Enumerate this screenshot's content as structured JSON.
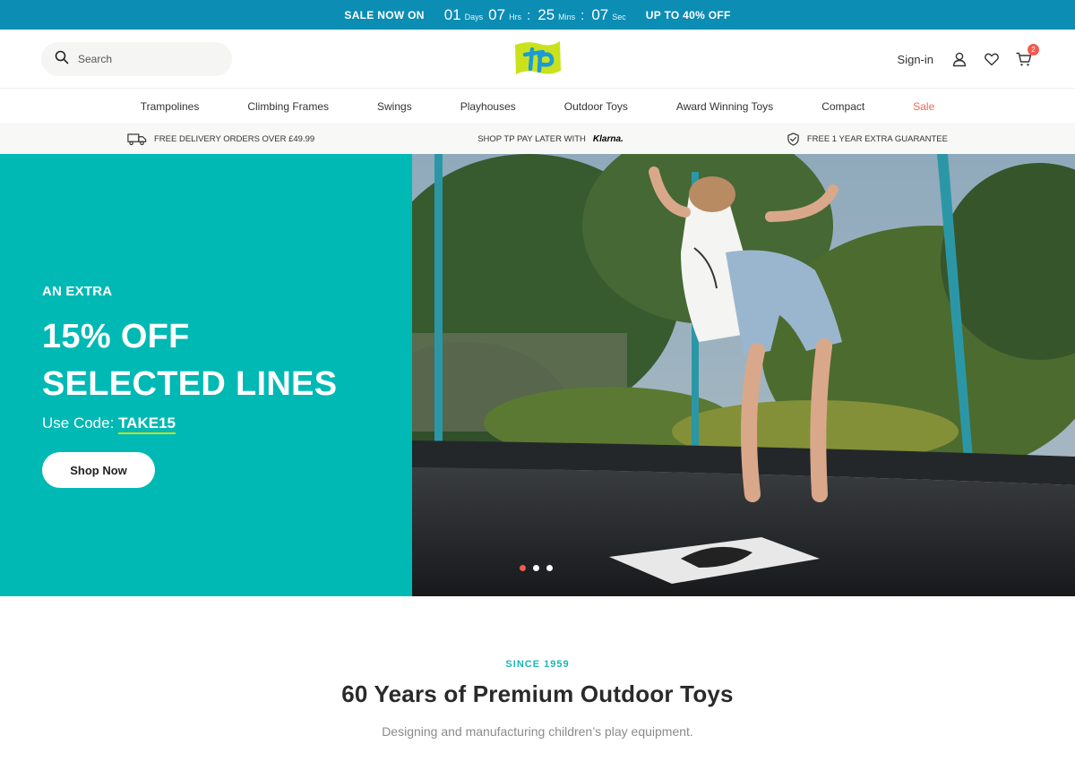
{
  "topbar": {
    "sale_label": "SALE NOW ON",
    "countdown": [
      {
        "value": "01",
        "unit": "Days"
      },
      {
        "value": "07",
        "unit": "Hrs"
      },
      {
        "value": "25",
        "unit": "Mins"
      },
      {
        "value": "07",
        "unit": "Sec"
      }
    ],
    "offer_label": "UP TO 40% OFF",
    "bg_color": "#0b8db4"
  },
  "header": {
    "search_placeholder": "Search",
    "signin_label": "Sign-in",
    "cart_count": "2"
  },
  "nav": {
    "items": [
      "Trampolines",
      "Climbing Frames",
      "Swings",
      "Playhouses",
      "Outdoor Toys",
      "Award Winning Toys",
      "Compact",
      "Sale"
    ],
    "sale_color": "#f0665a"
  },
  "info": {
    "delivery": "FREE DELIVERY ORDERS OVER £49.99",
    "pay_later": "SHOP TP PAY LATER WITH",
    "klarna": "Klarna.",
    "guarantee": "FREE 1 YEAR EXTRA GUARANTEE"
  },
  "hero": {
    "eyebrow": "AN EXTRA",
    "headline_line1": "15% OFF",
    "headline_line2": "SELECTED LINES",
    "code_prefix": "Use Code:",
    "code": "TAKE15",
    "cta": "Shop Now",
    "bg_color": "#00b9b4",
    "slides_total": 3,
    "active_slide": 1
  },
  "intro": {
    "eyebrow": "SINCE 1959",
    "title": "60 Years of Premium Outdoor Toys",
    "subtitle": "Designing and manufacturing children’s play equipment."
  }
}
